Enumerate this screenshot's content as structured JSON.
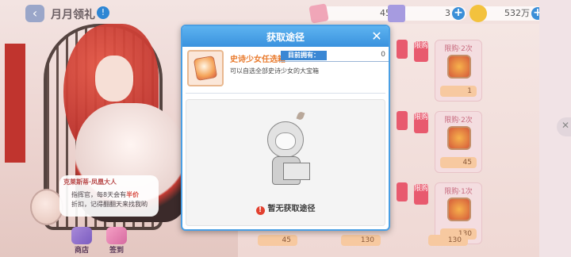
{
  "header": {
    "back_label": "‹",
    "title": "月月领礼",
    "info_label": "!"
  },
  "resources": [
    {
      "icon": "ticket-icon",
      "value": "45",
      "plus": "+"
    },
    {
      "icon": "gem-icon",
      "value": "3",
      "plus": "+"
    },
    {
      "icon": "coin-icon",
      "value": "532万",
      "plus": "+"
    }
  ],
  "shop_cards": [
    {
      "tag": "限购",
      "label": "限购·2次",
      "price": "1"
    },
    {
      "tag": "限购",
      "label": "限购·2次",
      "price": "45"
    },
    {
      "tag": "限购",
      "label": "限购·1次",
      "price": "130"
    }
  ],
  "bottom_prices": [
    "45",
    "130",
    "130"
  ],
  "tip": {
    "title": "克莱斯蒂·凤凰大人",
    "line1_pre": "指挥官，每8天会有",
    "line1_half": "半价",
    "line2_a": "折扣，记得翻翻天来找我哟",
    "line2_b": ""
  },
  "bottom_buttons": [
    {
      "label": "商店"
    },
    {
      "label": "签到"
    }
  ],
  "modal": {
    "title": "获取途径",
    "close": "✕",
    "item_name": "史诗少女任选箱",
    "owned_label": "目前拥有：",
    "owned_value": "0",
    "item_desc": "可以自选全部史诗少女的大宝箱",
    "empty_text": "暂无获取途径",
    "warn_icon": "!"
  },
  "colors": {
    "accent": "#3a92de",
    "item_name": "#e97a2c",
    "warning": "#e2412f"
  }
}
